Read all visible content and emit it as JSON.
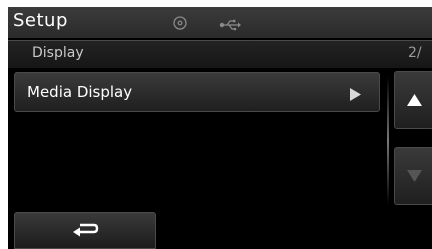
{
  "header": {
    "title": "Setup",
    "icons": [
      "disc-icon",
      "usb-icon"
    ]
  },
  "subheader": {
    "section": "Display",
    "page_indicator": "2/"
  },
  "list": {
    "items": [
      {
        "label": "Media Display",
        "icon": "play-arrow-icon"
      }
    ]
  },
  "scroll": {
    "up_icon": "up-arrow-icon",
    "down_icon": "down-arrow-icon"
  },
  "footer": {
    "back_icon": "back-arrow-icon"
  },
  "colors": {
    "background": "#000000",
    "bar": "#2f2f2f",
    "text": "#ffffff",
    "muted_text": "#c8c8c8",
    "disabled_arrow": "#555555"
  }
}
